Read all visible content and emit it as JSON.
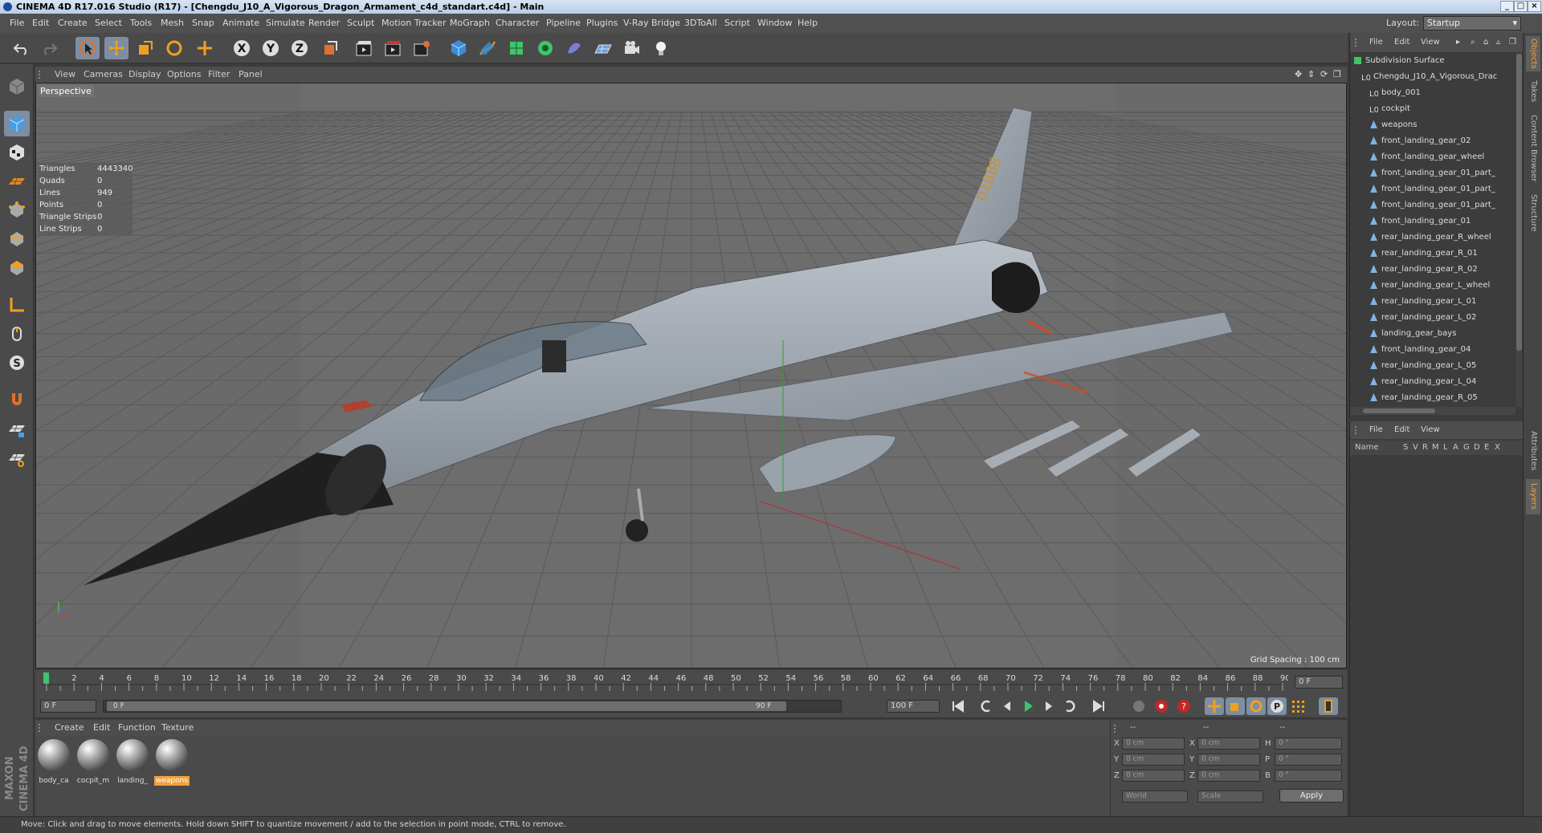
{
  "window": {
    "title": "CINEMA 4D R17.016 Studio (R17) - [Chengdu_J10_A_Vigorous_Dragon_Armament_c4d_standart.c4d] - Main",
    "controls": [
      "_",
      "□",
      "×"
    ]
  },
  "menubar": {
    "items": [
      "File",
      "Edit",
      "Create",
      "Select",
      "Tools",
      "Mesh",
      "Snap",
      "Animate",
      "Simulate",
      "Render",
      "Sculpt",
      "Motion Tracker",
      "MoGraph",
      "Character",
      "Pipeline",
      "Plugins",
      "V-Ray Bridge",
      "3DToAll",
      "Script",
      "Window",
      "Help"
    ],
    "layout_label": "Layout:",
    "layout_value": "Startup"
  },
  "toolbar": {
    "icons": [
      "undo-icon",
      "redo-icon",
      "live-selection-icon",
      "move-icon",
      "scale-icon",
      "rotate-icon",
      "move-axis-icon",
      "x-axis-icon",
      "y-axis-icon",
      "z-axis-icon",
      "coordinate-system-icon",
      "render-view-icon",
      "render-picture-viewer-icon",
      "edit-render-settings-icon",
      "cube-icon",
      "pen-spline-icon",
      "subdivision-surface-icon",
      "cloner-icon",
      "deformer-icon",
      "floor-icon",
      "camera-icon",
      "light-icon"
    ],
    "axis_labels": [
      "X",
      "Y",
      "Z"
    ]
  },
  "left_tools": {
    "icons": [
      "make-editable-icon",
      "model-mode-icon",
      "texture-mode-icon",
      "workplane-icon",
      "points-mode-icon",
      "edges-mode-icon",
      "polygons-mode-icon",
      "axis-mode-icon",
      "tweak-mode-icon",
      "solo-mode-icon",
      "snap-icon",
      "locked-workplane-icon",
      "planar-workplane-icon"
    ],
    "solo_label": "S"
  },
  "viewport": {
    "menu": [
      "View",
      "Cameras",
      "Display",
      "Options",
      "Filter",
      "Panel"
    ],
    "label": "Perspective",
    "stats": [
      {
        "name": "Triangles",
        "value": "4443340"
      },
      {
        "name": "Quads",
        "value": "0"
      },
      {
        "name": "Lines",
        "value": "949"
      },
      {
        "name": "Points",
        "value": "0"
      },
      {
        "name": "Triangle Strips",
        "value": "0"
      },
      {
        "name": "Line Strips",
        "value": "0"
      }
    ],
    "grid_spacing": "Grid Spacing : 100 cm",
    "aircraft_marking": "01888"
  },
  "timeline": {
    "ticks": [
      "0",
      "2",
      "4",
      "6",
      "8",
      "10",
      "12",
      "14",
      "16",
      "18",
      "20",
      "22",
      "24",
      "26",
      "28",
      "30",
      "32",
      "34",
      "36",
      "38",
      "40",
      "42",
      "44",
      "46",
      "48",
      "50",
      "52",
      "54",
      "56",
      "58",
      "60",
      "62",
      "64",
      "66",
      "68",
      "70",
      "72",
      "74",
      "76",
      "78",
      "80",
      "82",
      "84",
      "86",
      "88",
      "90"
    ],
    "current_frame": "0 F"
  },
  "playbar": {
    "start_field": "0 F",
    "range_start": "0 F",
    "range_end": "90 F",
    "end_field": "100 F"
  },
  "material_manager": {
    "menu": [
      "Create",
      "Edit",
      "Function",
      "Texture"
    ],
    "materials": [
      {
        "name": "body_ca",
        "selected": false
      },
      {
        "name": "cocpit_m",
        "selected": false
      },
      {
        "name": "landing_",
        "selected": false
      },
      {
        "name": "weapons",
        "selected": true
      }
    ]
  },
  "coordinates": {
    "header": [
      "--",
      "--",
      "--"
    ],
    "rows": [
      {
        "a": "X",
        "av": "0 cm",
        "b": "X",
        "bv": "0 cm",
        "c": "H",
        "cv": "0 °"
      },
      {
        "a": "Y",
        "av": "0 cm",
        "b": "Y",
        "bv": "0 cm",
        "c": "P",
        "cv": "0 °"
      },
      {
        "a": "Z",
        "av": "0 cm",
        "b": "Z",
        "bv": "0 cm",
        "c": "B",
        "cv": "0 °"
      }
    ],
    "mode": "World",
    "scale": "Scale",
    "apply": "Apply"
  },
  "status": {
    "text": "Move: Click and drag to move elements. Hold down SHIFT to quantize movement / add to the selection in point mode, CTRL to remove."
  },
  "object_manager": {
    "menu": [
      "File",
      "Edit",
      "View"
    ],
    "objects": [
      {
        "name": "Subdivision Surface",
        "type": "subdivision",
        "indent": 0
      },
      {
        "name": "Chengdu_J10_A_Vigorous_Drac",
        "type": "null",
        "indent": 1
      },
      {
        "name": "body_001",
        "type": "null",
        "indent": 2
      },
      {
        "name": "cockpit",
        "type": "null",
        "indent": 2
      },
      {
        "name": "weapons",
        "type": "mesh",
        "indent": 2
      },
      {
        "name": "front_landing_gear_02",
        "type": "mesh",
        "indent": 2
      },
      {
        "name": "front_landing_gear_wheel",
        "type": "mesh",
        "indent": 2
      },
      {
        "name": "front_landing_gear_01_part_",
        "type": "mesh",
        "indent": 2
      },
      {
        "name": "front_landing_gear_01_part_",
        "type": "mesh",
        "indent": 2
      },
      {
        "name": "front_landing_gear_01_part_",
        "type": "mesh",
        "indent": 2
      },
      {
        "name": "front_landing_gear_01",
        "type": "mesh",
        "indent": 2
      },
      {
        "name": "rear_landing_gear_R_wheel",
        "type": "mesh",
        "indent": 2
      },
      {
        "name": "rear_landing_gear_R_01",
        "type": "mesh",
        "indent": 2
      },
      {
        "name": "rear_landing_gear_R_02",
        "type": "mesh",
        "indent": 2
      },
      {
        "name": "rear_landing_gear_L_wheel",
        "type": "mesh",
        "indent": 2
      },
      {
        "name": "rear_landing_gear_L_01",
        "type": "mesh",
        "indent": 2
      },
      {
        "name": "rear_landing_gear_L_02",
        "type": "mesh",
        "indent": 2
      },
      {
        "name": "landing_gear_bays",
        "type": "mesh",
        "indent": 2
      },
      {
        "name": "front_landing_gear_04",
        "type": "mesh",
        "indent": 2
      },
      {
        "name": "rear_landing_gear_L_05",
        "type": "mesh",
        "indent": 2
      },
      {
        "name": "rear_landing_gear_L_04",
        "type": "mesh",
        "indent": 2
      },
      {
        "name": "rear_landing_gear_R_05",
        "type": "mesh",
        "indent": 2
      }
    ]
  },
  "attribute_manager": {
    "menu": [
      "File",
      "Edit",
      "View"
    ],
    "columns": [
      "Name",
      "S",
      "V",
      "R",
      "M",
      "L",
      "A",
      "G",
      "D",
      "E",
      "X"
    ]
  },
  "side_tabs": {
    "top": [
      "Objects",
      "Takes",
      "Content Browser",
      "Structure"
    ],
    "bottom": [
      "Attributes",
      "Layers"
    ]
  },
  "colors": {
    "accent": "#f2a03c",
    "active_tool": "#7d8ea3",
    "viewport_bg": "#6b6b6b",
    "panel_bg": "#4a4a4a"
  }
}
